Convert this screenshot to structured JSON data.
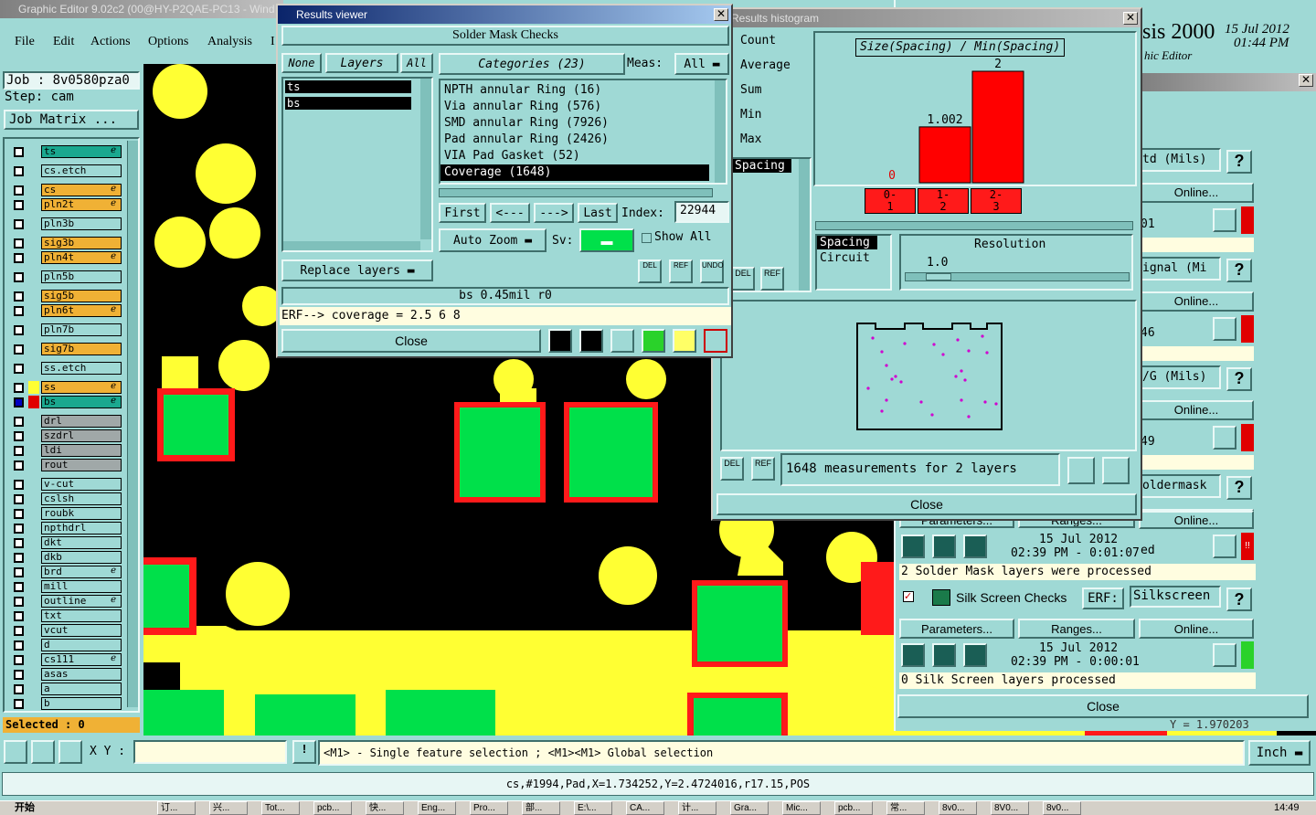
{
  "main_window": {
    "title": "Graphic Editor 9.02c2 (00@HY-P2QAE-PC13 - Wind",
    "menu": [
      "File",
      "Edit",
      "Actions",
      "Options",
      "Analysis",
      "I"
    ],
    "job": "Job : 8v0580pza0",
    "step": "Step: cam",
    "job_matrix": "Job Matrix ...",
    "selected": "Selected : 0"
  },
  "layers": [
    {
      "name": "ts",
      "color": "#1aa88f",
      "mark": "ℯ"
    },
    {
      "name": "cs.etch",
      "color": "#9fd9d5",
      "mark": ""
    },
    {
      "name": "cs",
      "color": "#f0b135",
      "mark": "ℯ"
    },
    {
      "name": "pln2t",
      "color": "#f0b135",
      "mark": "ℯ"
    },
    {
      "name": "pln3b",
      "color": "#9fd9d5",
      "mark": ""
    },
    {
      "name": "sig3b",
      "color": "#f0b135",
      "mark": ""
    },
    {
      "name": "pln4t",
      "color": "#f0b135",
      "mark": "ℯ"
    },
    {
      "name": "pln5b",
      "color": "#9fd9d5",
      "mark": ""
    },
    {
      "name": "sig5b",
      "color": "#f0b135",
      "mark": ""
    },
    {
      "name": "pln6t",
      "color": "#f0b135",
      "mark": "ℯ"
    },
    {
      "name": "pln7b",
      "color": "#9fd9d5",
      "mark": ""
    },
    {
      "name": "sig7b",
      "color": "#f0b135",
      "mark": ""
    },
    {
      "name": "ss.etch",
      "color": "#9fd9d5",
      "mark": ""
    },
    {
      "name": "ss",
      "color": "#f0b135",
      "mark": "ℯ"
    },
    {
      "name": "bs",
      "color": "#1aa88f",
      "mark": "ℯ"
    },
    {
      "name": "drl",
      "color": "#a0a8a8",
      "mark": ""
    },
    {
      "name": "szdrl",
      "color": "#a0a8a8",
      "mark": ""
    },
    {
      "name": "ldi",
      "color": "#a0a8a8",
      "mark": ""
    },
    {
      "name": "rout",
      "color": "#a0a8a8",
      "mark": ""
    },
    {
      "name": "v-cut",
      "color": "#9fd9d5",
      "mark": ""
    },
    {
      "name": "cslsh",
      "color": "#9fd9d5",
      "mark": ""
    },
    {
      "name": "roubk",
      "color": "#9fd9d5",
      "mark": ""
    },
    {
      "name": "npthdrl",
      "color": "#9fd9d5",
      "mark": ""
    },
    {
      "name": "dkt",
      "color": "#9fd9d5",
      "mark": ""
    },
    {
      "name": "dkb",
      "color": "#9fd9d5",
      "mark": ""
    },
    {
      "name": "brd",
      "color": "#9fd9d5",
      "mark": "ℯ"
    },
    {
      "name": "mill",
      "color": "#9fd9d5",
      "mark": ""
    },
    {
      "name": "outline",
      "color": "#9fd9d5",
      "mark": "ℯ"
    },
    {
      "name": "txt",
      "color": "#9fd9d5",
      "mark": ""
    },
    {
      "name": "vcut",
      "color": "#9fd9d5",
      "mark": ""
    },
    {
      "name": "d",
      "color": "#9fd9d5",
      "mark": ""
    },
    {
      "name": "cs111",
      "color": "#9fd9d5",
      "mark": "ℯ"
    },
    {
      "name": "asas",
      "color": "#9fd9d5",
      "mark": ""
    },
    {
      "name": "a",
      "color": "#9fd9d5",
      "mark": ""
    },
    {
      "name": "b",
      "color": "#9fd9d5",
      "mark": ""
    }
  ],
  "results_viewer": {
    "title": "Results viewer",
    "heading": "Solder Mask Checks",
    "none": "None",
    "layers_label": "Layers",
    "all": "All",
    "categories_label": "Categories (23)",
    "meas_label": "Meas:",
    "meas_value": "All",
    "layer_list": [
      "ts",
      "bs"
    ],
    "categories": [
      "NPTH annular Ring (16)",
      "Via annular Ring (576)",
      "SMD annular Ring (7926)",
      "Pad annular Ring (2426)",
      "VIA Pad Gasket (52)",
      "Coverage (1648)"
    ],
    "first": "First",
    "prev": "<---",
    "next": "--->",
    "last": "Last",
    "index_label": "Index:",
    "index_value": "22944",
    "auto_zoom": "Auto Zoom",
    "sv_label": "Sv:",
    "show_all": "Show All",
    "replace_layers": "Replace layers",
    "status": "bs 0.45mil  r0",
    "erf": "ERF--> coverage = 2.5 6 8",
    "close": "Close",
    "del": "DEL",
    "ref": "REF",
    "undo": "UNDO"
  },
  "histogram": {
    "title": "Results histogram",
    "stats": [
      "Count",
      "Average",
      "Sum",
      "Min",
      "Max"
    ],
    "stat_list_item": "Spacing",
    "chart_title": "Size(Spacing) / Min(Spacing)",
    "spacing_opt": "Spacing",
    "circuit_opt": "Circuit",
    "resolution_label": "Resolution",
    "resolution_value": "1.0",
    "summary": "1648 measurements for 2 layers",
    "close": "Close",
    "del": "DEL",
    "ref": "REF"
  },
  "chart_data": {
    "type": "bar",
    "title": "Size(Spacing) / Min(Spacing)",
    "categories": [
      "0-1",
      "1-2",
      "2-3"
    ],
    "values": [
      0,
      1.002,
      2
    ],
    "data_labels": [
      "0",
      "1.002",
      "2"
    ],
    "color": "#ff0000"
  },
  "analysis": {
    "brand": "sis 2000",
    "date": "15 Jul 2012",
    "time": "01:44 PM",
    "subtitle": "hic Editor",
    "rows": [
      {
        "label": "td (Mils)",
        "online": "Online...",
        "val": "01"
      },
      {
        "label": "ignal (Mi",
        "online": "Online...",
        "val": "46"
      },
      {
        "label": "/G (Mils)",
        "online": "Online...",
        "val": "49"
      },
      {
        "label": "oldermask",
        "online": "Online...",
        "val": "ed"
      }
    ],
    "sm_date": "15 Jul 2012",
    "sm_time": "02:39 PM - 0:01:07",
    "sm_status": "2 Solder Mask layers were processed",
    "parameters": "Parameters...",
    "ranges": "Ranges...",
    "online": "Online...",
    "silk_label": "Silk Screen Checks",
    "erf_label": "ERF:",
    "silk_erf": "Silkscreen",
    "silk_date": "15 Jul 2012",
    "silk_time": "02:39 PM - 0:00:01",
    "silk_status": "0 Silk Screen layers processed",
    "close": "Close",
    "readout": "Y = 1.970203"
  },
  "bottom": {
    "xy_label": "X Y :",
    "hint": "<M1> - Single feature selection ; <M1><M1> Global selection",
    "unit": "Inch",
    "feature_info": "cs,#1994,Pad,X=1.734252,Y=2.4724016,r17.15,POS"
  },
  "taskbar": {
    "start": "开始",
    "items": [
      "订...",
      "兴...",
      "Tot...",
      "pcb...",
      "快...",
      "Eng...",
      "Pro...",
      "部...",
      "E:\\...",
      "CA...",
      "计...",
      "Gra...",
      "Mic...",
      "pcb...",
      "常...",
      "8v0...",
      "8V0...",
      "8v0..."
    ],
    "clock": "14:49"
  }
}
